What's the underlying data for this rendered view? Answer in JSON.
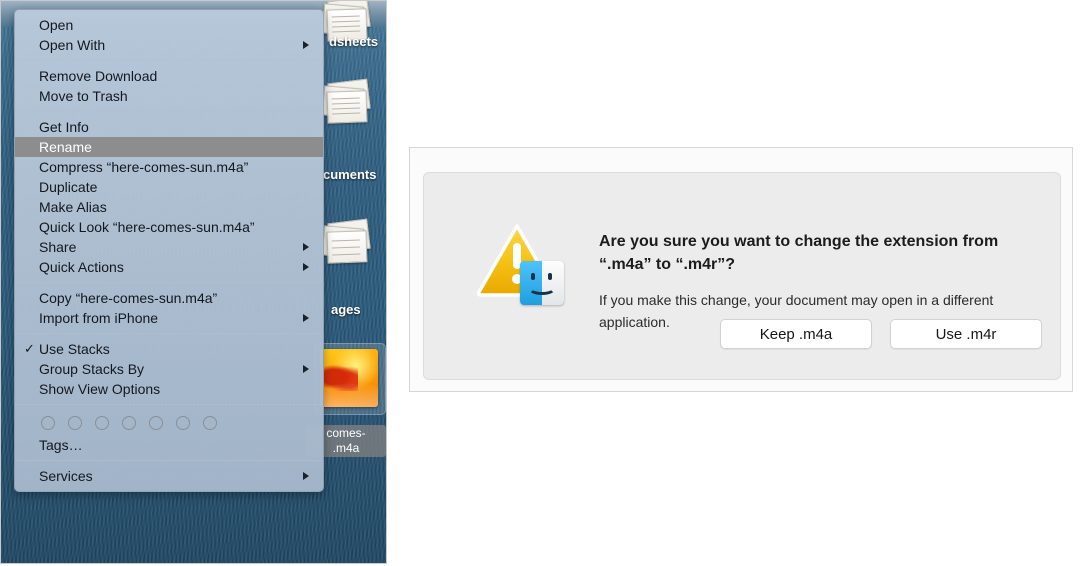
{
  "desktop": {
    "stacks": [
      {
        "label": "Spreadsheets",
        "visible_label": "dsheets"
      },
      {
        "label": "Documents",
        "visible_label": "cuments"
      },
      {
        "label": "Images",
        "visible_label": "ages"
      }
    ],
    "selected_file": {
      "label_line1": "comes-",
      "label_line2": ".m4a",
      "full_name": "here-comes-sun.m4a"
    }
  },
  "context_menu": {
    "groups": [
      {
        "items": [
          {
            "label": "Open",
            "submenu": false,
            "checked": false,
            "selected": false
          },
          {
            "label": "Open With",
            "submenu": true,
            "checked": false,
            "selected": false
          }
        ]
      },
      {
        "items": [
          {
            "label": "Remove Download",
            "submenu": false,
            "checked": false,
            "selected": false
          },
          {
            "label": "Move to Trash",
            "submenu": false,
            "checked": false,
            "selected": false
          }
        ]
      },
      {
        "items": [
          {
            "label": "Get Info",
            "submenu": false,
            "checked": false,
            "selected": false
          },
          {
            "label": "Rename",
            "submenu": false,
            "checked": false,
            "selected": true
          },
          {
            "label": "Compress “here-comes-sun.m4a”",
            "submenu": false,
            "checked": false,
            "selected": false
          },
          {
            "label": "Duplicate",
            "submenu": false,
            "checked": false,
            "selected": false
          },
          {
            "label": "Make Alias",
            "submenu": false,
            "checked": false,
            "selected": false
          },
          {
            "label": "Quick Look “here-comes-sun.m4a”",
            "submenu": false,
            "checked": false,
            "selected": false
          },
          {
            "label": "Share",
            "submenu": true,
            "checked": false,
            "selected": false
          },
          {
            "label": "Quick Actions",
            "submenu": true,
            "checked": false,
            "selected": false
          }
        ]
      },
      {
        "items": [
          {
            "label": "Copy “here-comes-sun.m4a”",
            "submenu": false,
            "checked": false,
            "selected": false
          },
          {
            "label": "Import from iPhone",
            "submenu": true,
            "checked": false,
            "selected": false
          }
        ]
      },
      {
        "items": [
          {
            "label": "Use Stacks",
            "submenu": false,
            "checked": true,
            "selected": false
          },
          {
            "label": "Group Stacks By",
            "submenu": true,
            "checked": false,
            "selected": false
          },
          {
            "label": "Show View Options",
            "submenu": false,
            "checked": false,
            "selected": false
          }
        ]
      },
      {
        "tags": true,
        "tag_count": 7,
        "items": [
          {
            "label": "Tags…",
            "submenu": false,
            "checked": false,
            "selected": false
          }
        ]
      },
      {
        "items": [
          {
            "label": "Services",
            "submenu": true,
            "checked": false,
            "selected": false
          }
        ]
      }
    ]
  },
  "dialog": {
    "heading": "Are you sure you want to change the extension from “.m4a” to “.m4r”?",
    "body": "If you make this change, your document may open in a different application.",
    "buttons": [
      {
        "label": "Keep .m4a"
      },
      {
        "label": "Use .m4r"
      }
    ]
  },
  "colors": {
    "menu_background": "#b6c8dc",
    "menu_selected": "#8d8d8d",
    "dialog_panel": "#ececec",
    "caution_yellow": "#f5c518",
    "finder_blue": "#1e9fe0"
  }
}
